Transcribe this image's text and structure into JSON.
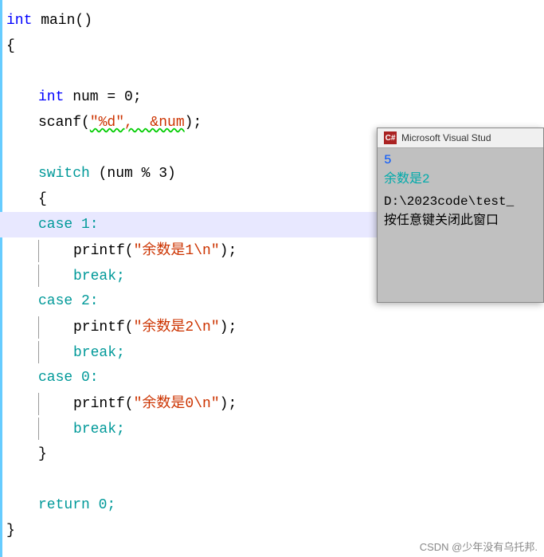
{
  "editor": {
    "lines": [
      {
        "id": 1,
        "indent": 0,
        "tokens": [
          {
            "text": "int",
            "color": "c-blue"
          },
          {
            "text": " main()",
            "color": "c-black"
          }
        ],
        "highlighted": false
      },
      {
        "id": 2,
        "indent": 0,
        "tokens": [
          {
            "text": "{",
            "color": "c-black"
          }
        ],
        "highlighted": false
      },
      {
        "id": 3,
        "indent": 1,
        "tokens": [],
        "highlighted": false
      },
      {
        "id": 4,
        "indent": 1,
        "tokens": [
          {
            "text": "int",
            "color": "c-blue"
          },
          {
            "text": " num = 0;",
            "color": "c-black"
          }
        ],
        "highlighted": false
      },
      {
        "id": 5,
        "indent": 1,
        "tokens": [
          {
            "text": "scanf",
            "color": "c-black"
          },
          {
            "text": "(",
            "color": "c-black"
          },
          {
            "text": "\"%d\"",
            "color": "c-red",
            "squiggly": true
          },
          {
            "text": ", ",
            "color": "c-black"
          },
          {
            "text": "&num",
            "color": "c-black",
            "squiggly": true
          },
          {
            "text": ");",
            "color": "c-black"
          }
        ],
        "highlighted": false
      },
      {
        "id": 6,
        "indent": 1,
        "tokens": [],
        "highlighted": false
      },
      {
        "id": 7,
        "indent": 1,
        "tokens": [
          {
            "text": "switch",
            "color": "c-teal"
          },
          {
            "text": " (num % 3)",
            "color": "c-black"
          }
        ],
        "highlighted": false
      },
      {
        "id": 8,
        "indent": 1,
        "tokens": [
          {
            "text": "{",
            "color": "c-black"
          }
        ],
        "highlighted": false
      },
      {
        "id": 9,
        "indent": 1,
        "tokens": [
          {
            "text": "case 1:",
            "color": "c-teal"
          }
        ],
        "highlighted": true
      },
      {
        "id": 10,
        "indent": 2,
        "tokens": [
          {
            "text": "printf(",
            "color": "c-black"
          },
          {
            "text": "\"余数是1\\n\"",
            "color": "c-red"
          },
          {
            "text": ");",
            "color": "c-black"
          }
        ],
        "highlighted": false
      },
      {
        "id": 11,
        "indent": 2,
        "tokens": [
          {
            "text": "break;",
            "color": "c-teal"
          }
        ],
        "highlighted": false
      },
      {
        "id": 12,
        "indent": 1,
        "tokens": [
          {
            "text": "case 2:",
            "color": "c-teal"
          }
        ],
        "highlighted": false
      },
      {
        "id": 13,
        "indent": 2,
        "tokens": [
          {
            "text": "printf(",
            "color": "c-black"
          },
          {
            "text": "\"余数是2\\n\"",
            "color": "c-red"
          },
          {
            "text": ");",
            "color": "c-black"
          }
        ],
        "highlighted": false
      },
      {
        "id": 14,
        "indent": 2,
        "tokens": [
          {
            "text": "break;",
            "color": "c-teal"
          }
        ],
        "highlighted": false
      },
      {
        "id": 15,
        "indent": 1,
        "tokens": [
          {
            "text": "case 0:",
            "color": "c-teal"
          }
        ],
        "highlighted": false
      },
      {
        "id": 16,
        "indent": 2,
        "tokens": [
          {
            "text": "printf(",
            "color": "c-black"
          },
          {
            "text": "\"余数是0\\n\"",
            "color": "c-red"
          },
          {
            "text": ");",
            "color": "c-black"
          }
        ],
        "highlighted": false
      },
      {
        "id": 17,
        "indent": 2,
        "tokens": [
          {
            "text": "break;",
            "color": "c-teal"
          }
        ],
        "highlighted": false
      },
      {
        "id": 18,
        "indent": 1,
        "tokens": [
          {
            "text": "}",
            "color": "c-black"
          }
        ],
        "highlighted": false
      },
      {
        "id": 19,
        "indent": 1,
        "tokens": [],
        "highlighted": false
      },
      {
        "id": 20,
        "indent": 1,
        "tokens": [
          {
            "text": "return 0;",
            "color": "c-teal"
          }
        ],
        "highlighted": false
      },
      {
        "id": 21,
        "indent": 0,
        "tokens": [
          {
            "text": "}",
            "color": "c-black"
          }
        ],
        "highlighted": false
      }
    ]
  },
  "terminal": {
    "title": "Microsoft Visual Stud",
    "lines": [
      {
        "text": "5",
        "color": "terminal-line-blue"
      },
      {
        "text": "余数是2",
        "color": "terminal-line-cyan"
      },
      {
        "text": "",
        "color": "terminal-line-black"
      },
      {
        "text": "D:\\2023code\\test_",
        "color": "terminal-line-black"
      },
      {
        "text": "按任意键关闭此窗口",
        "color": "terminal-line-black"
      }
    ]
  },
  "watermark": {
    "text": "CSDN @少年没有乌托邦."
  }
}
